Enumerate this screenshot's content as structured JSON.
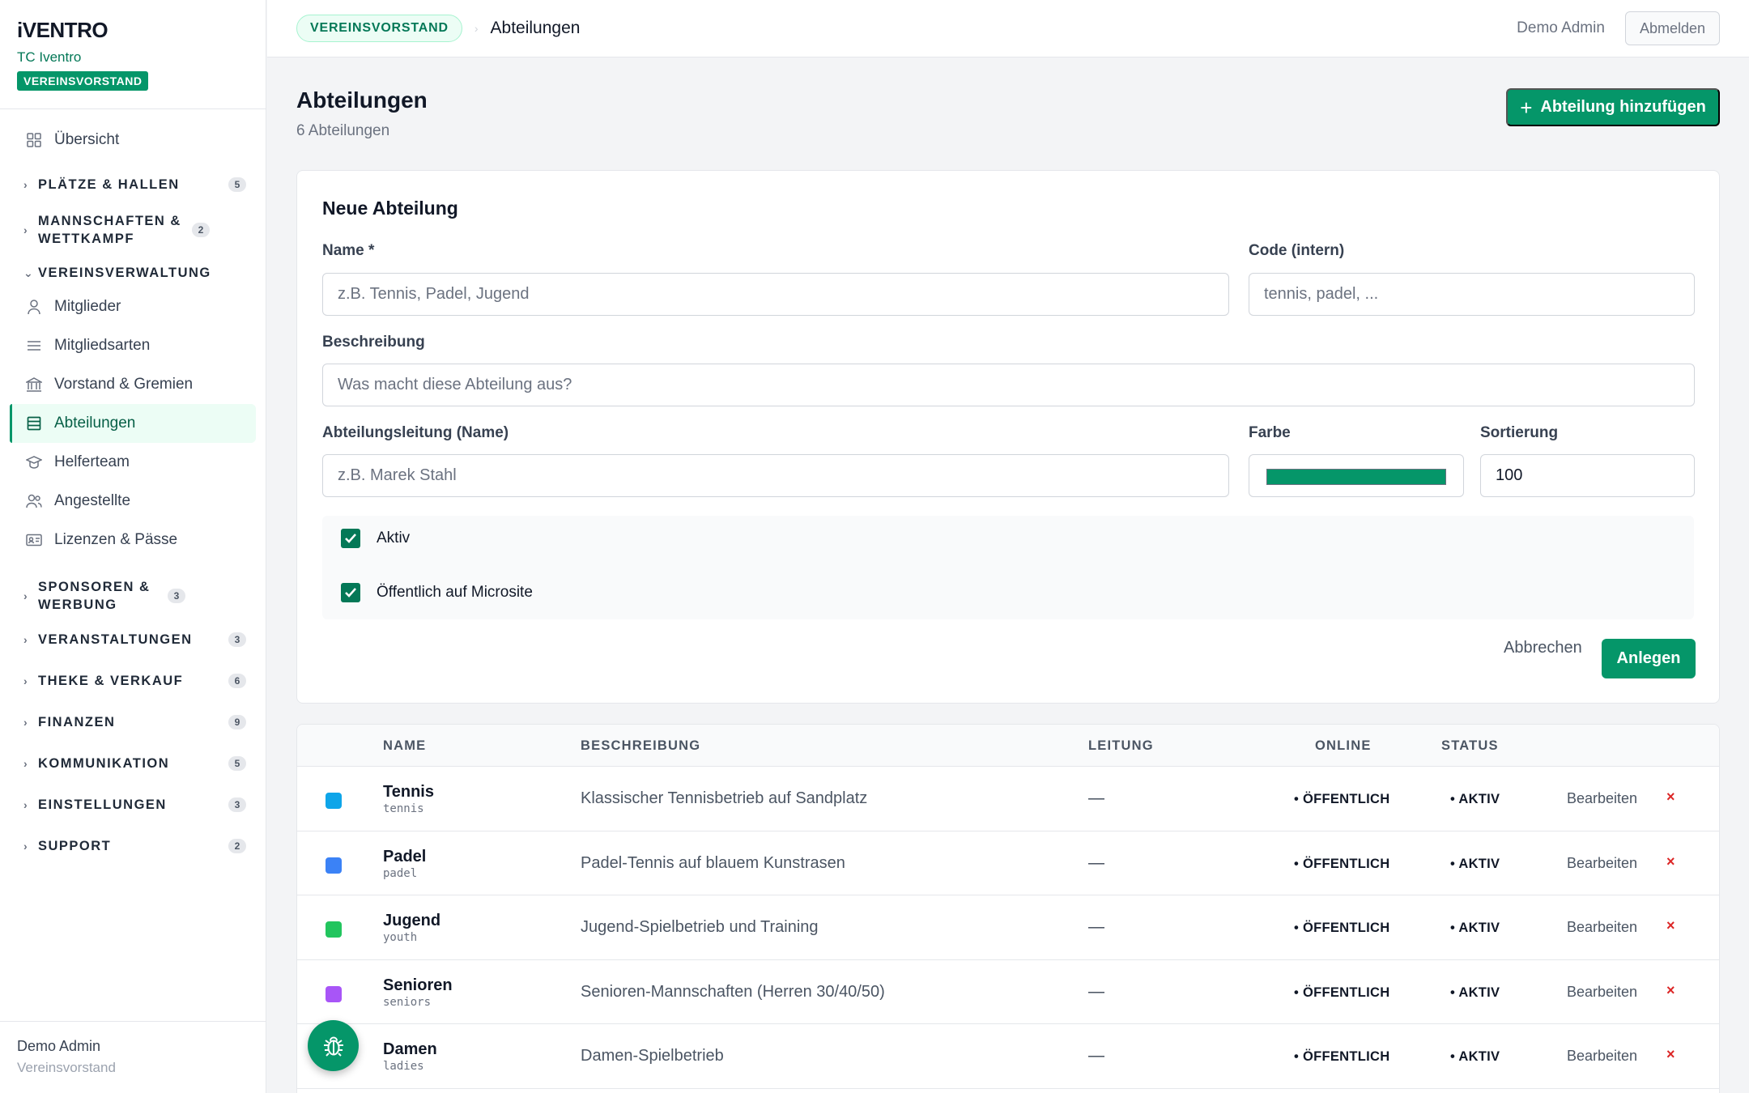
{
  "brand": {
    "logo": "iVENTRO",
    "club": "TC Iventro",
    "role": "VEREINSVORSTAND"
  },
  "nav": {
    "overview": "Übersicht",
    "groups": [
      {
        "label": "PLÄTZE & HALLEN",
        "count": "5"
      },
      {
        "label": "MANNSCHAFTEN & WETTKAMPF",
        "count": "2"
      },
      {
        "label": "VEREINSVERWALTUNG"
      },
      {
        "label": "SPONSOREN & WERBUNG",
        "count": "3"
      },
      {
        "label": "VERANSTALTUNGEN",
        "count": "3"
      },
      {
        "label": "THEKE & VERKAUF",
        "count": "6"
      },
      {
        "label": "FINANZEN",
        "count": "9"
      },
      {
        "label": "KOMMUNIKATION",
        "count": "5"
      },
      {
        "label": "EINSTELLUNGEN",
        "count": "3"
      },
      {
        "label": "SUPPORT",
        "count": "2"
      }
    ],
    "items": [
      {
        "label": "Mitglieder",
        "icon": "user-icon"
      },
      {
        "label": "Mitgliedsarten",
        "icon": "list-icon"
      },
      {
        "label": "Vorstand & Gremien",
        "icon": "building-icon"
      },
      {
        "label": "Abteilungen",
        "icon": "table-icon"
      },
      {
        "label": "Helferteam",
        "icon": "graduation-cap-icon"
      },
      {
        "label": "Angestellte",
        "icon": "users-icon"
      },
      {
        "label": "Lizenzen & Pässe",
        "icon": "id-card-icon"
      }
    ]
  },
  "sidebar_footer": {
    "name": "Demo Admin",
    "role": "Vereinsvorstand"
  },
  "topbar": {
    "badge": "VEREINSVORSTAND",
    "separator": "›",
    "current": "Abteilungen",
    "user": "Demo Admin",
    "logout": "Abmelden"
  },
  "page": {
    "title": "Abteilungen",
    "subtitle": "6 Abteilungen",
    "add_button": "Abteilung hinzufügen"
  },
  "form": {
    "title": "Neue Abteilung",
    "name_label": "Name *",
    "name_placeholder": "z.B. Tennis, Padel, Jugend",
    "code_label": "Code (intern)",
    "code_placeholder": "tennis, padel, ...",
    "desc_label": "Beschreibung",
    "desc_placeholder": "Was macht diese Abteilung aus?",
    "lead_label": "Abteilungsleitung (Name)",
    "lead_placeholder": "z.B. Marek Stahl",
    "color_label": "Farbe",
    "color_value": "#059669",
    "sort_label": "Sortierung",
    "sort_value": "100",
    "active_label": "Aktiv",
    "active_checked": true,
    "public_label": "Öffentlich auf Microsite",
    "public_checked": true,
    "cancel": "Abbrechen",
    "create": "Anlegen"
  },
  "table": {
    "headers": [
      "NAME",
      "BESCHREIBUNG",
      "LEITUNG",
      "ONLINE",
      "STATUS"
    ],
    "rows": [
      {
        "name": "Tennis",
        "code": "tennis",
        "color": "#0ea5e9",
        "description": "Klassischer Tennisbetrieb auf Sandplatz",
        "lead": "—",
        "online": "• ÖFFENTLICH",
        "status": "• AKTIV",
        "edit": "Bearbeiten",
        "delete": "×"
      },
      {
        "name": "Padel",
        "code": "padel",
        "color": "#3b82f6",
        "description": "Padel-Tennis auf blauem Kunstrasen",
        "lead": "—",
        "online": "• ÖFFENTLICH",
        "status": "• AKTIV",
        "edit": "Bearbeiten",
        "delete": "×"
      },
      {
        "name": "Jugend",
        "code": "youth",
        "color": "#22c55e",
        "description": "Jugend-Spielbetrieb und Training",
        "lead": "—",
        "online": "• ÖFFENTLICH",
        "status": "• AKTIV",
        "edit": "Bearbeiten",
        "delete": "×"
      },
      {
        "name": "Senioren",
        "code": "seniors",
        "color": "#a855f7",
        "description": "Senioren-Mannschaften (Herren 30/40/50)",
        "lead": "—",
        "online": "• ÖFFENTLICH",
        "status": "• AKTIV",
        "edit": "Bearbeiten",
        "delete": "×"
      },
      {
        "name": "Damen",
        "code": "ladies",
        "color": "#ec4899",
        "description": "Damen-Spielbetrieb",
        "lead": "—",
        "online": "• ÖFFENTLICH",
        "status": "• AKTIV",
        "edit": "Bearbeiten",
        "delete": "×"
      }
    ]
  },
  "fab": {
    "icon": "bug-icon"
  }
}
